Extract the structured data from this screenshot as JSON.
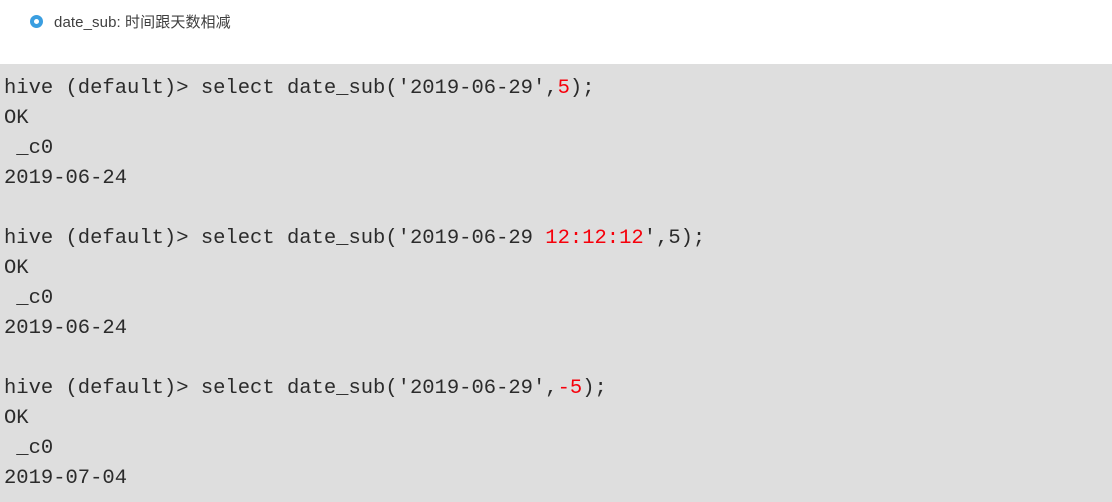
{
  "note": {
    "bullet_icon": "blue-ring-bullet-icon",
    "bullet_color": "#3a9ee0",
    "text": "date_sub: 时间跟天数相减"
  },
  "code_block": {
    "background_color": "#dedede",
    "text_color": "#2b2b2b",
    "highlight_color": "#f6000b",
    "prompt": "hive (default)> ",
    "blocks": [
      {
        "command_prefix": "hive (default)> select date_sub('2019-06-29',",
        "command_highlight": "5",
        "command_suffix": ");",
        "status": "OK",
        "column_header": " _c0",
        "result": "2019-06-24"
      },
      {
        "command_prefix": "hive (default)> select date_sub('2019-06-29 ",
        "command_highlight": "12:12:12",
        "command_suffix": "',5);",
        "status": "OK",
        "column_header": " _c0",
        "result": "2019-06-24"
      },
      {
        "command_prefix": "hive (default)> select date_sub('2019-06-29',",
        "command_highlight": "-5",
        "command_suffix": ");",
        "status": "OK",
        "column_header": " _c0",
        "result": "2019-07-04"
      }
    ]
  }
}
